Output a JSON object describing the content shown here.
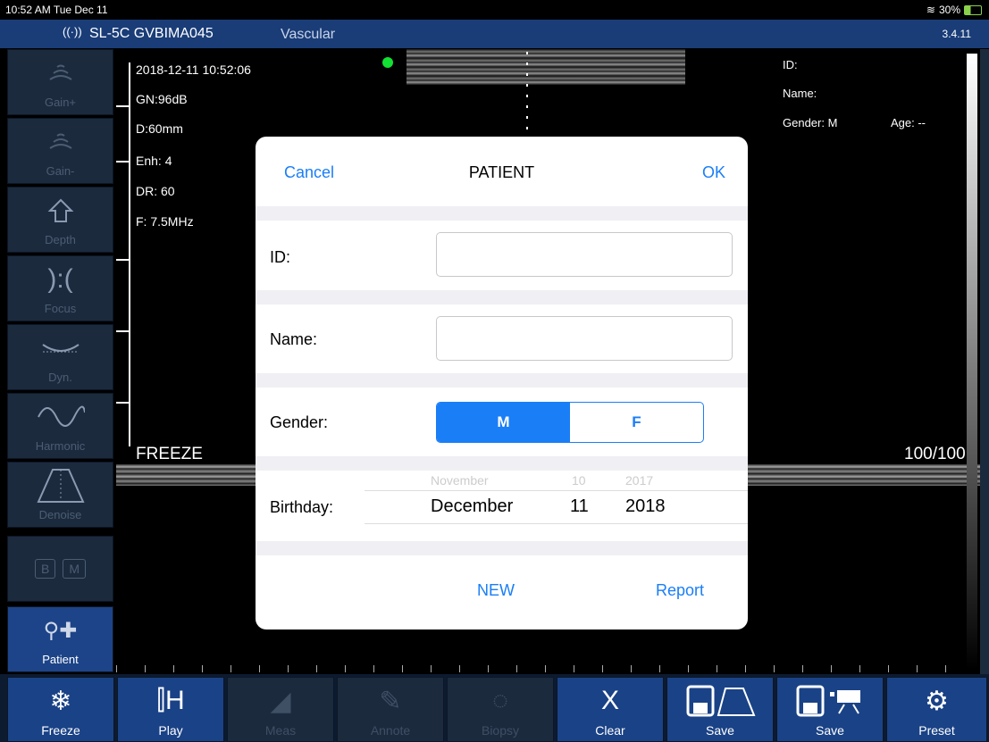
{
  "status_bar": {
    "time": "10:52 AM  Tue Dec 11",
    "battery": "30%"
  },
  "title_bar": {
    "probe": "SL-5C GVBIMA045",
    "exam_mode": "Vascular",
    "version": "3.4.11"
  },
  "left_tools": [
    {
      "label": "Gain+",
      "icon": "gain-up-icon"
    },
    {
      "label": "Gain-",
      "icon": "gain-down-icon"
    },
    {
      "label": "Depth",
      "icon": "depth-icon"
    },
    {
      "label": "Focus",
      "icon": "focus-icon"
    },
    {
      "label": "Dyn.",
      "icon": "dynamic-range-icon"
    },
    {
      "label": "Harmonic",
      "icon": "harmonic-icon"
    },
    {
      "label": "Denoise",
      "icon": "denoise-icon"
    },
    {
      "label": "",
      "icon": "b-m-mode-icon",
      "text_b": "B",
      "text_m": "M"
    },
    {
      "label": "Patient",
      "icon": "patient-icon"
    }
  ],
  "image_info": {
    "datetime": "2018-12-11 10:52:06",
    "gain": "GN:96dB",
    "depth": "D:60mm",
    "enhance": "Enh: 4",
    "dr": "DR: 60",
    "freq": "F: 7.5MHz",
    "freeze_label": "FREEZE",
    "frame_counter": "100/100"
  },
  "patient_info": {
    "id": "ID:",
    "name": "Name:",
    "gender": "Gender: M",
    "age": "Age: --"
  },
  "dialog": {
    "cancel": "Cancel",
    "title": "PATIENT",
    "ok": "OK",
    "id_label": "ID:",
    "id_value": "",
    "name_label": "Name:",
    "name_value": "",
    "gender_label": "Gender:",
    "gender_m": "M",
    "gender_f": "F",
    "gender_selected": "M",
    "birthday_label": "Birthday:",
    "birthday_month": "December",
    "birthday_day": "11",
    "birthday_year": "2018",
    "ghost_month_prev": "November",
    "ghost_day_prev": "10",
    "ghost_year_prev": "2017",
    "new_button": "NEW",
    "report_button": "Report"
  },
  "bottom_bar": [
    {
      "label": "Freeze",
      "icon": "snowflake-icon",
      "glyph": "❄",
      "enabled": true
    },
    {
      "label": "Play",
      "icon": "play-icon",
      "glyph": "⫿H",
      "enabled": true
    },
    {
      "label": "Meas",
      "icon": "measure-icon",
      "glyph": "◢",
      "enabled": false
    },
    {
      "label": "Annote",
      "icon": "annotate-icon",
      "glyph": "✎",
      "enabled": false
    },
    {
      "label": "Biopsy",
      "icon": "biopsy-icon",
      "glyph": "◌",
      "enabled": false
    },
    {
      "label": "Clear",
      "icon": "clear-icon",
      "glyph": "X",
      "enabled": true
    },
    {
      "label": "Save",
      "icon": "save-image-icon",
      "glyph": "💾",
      "enabled": true
    },
    {
      "label": "Save",
      "icon": "save-video-icon",
      "glyph": "💾",
      "enabled": true
    },
    {
      "label": "Preset",
      "icon": "gear-icon",
      "glyph": "⚙",
      "enabled": true
    }
  ],
  "colors": {
    "title_bar": "#1a3d78",
    "accent": "#1a7ef7",
    "tool_bg": "#1c2a3e",
    "active_tool": "#1d4488"
  }
}
